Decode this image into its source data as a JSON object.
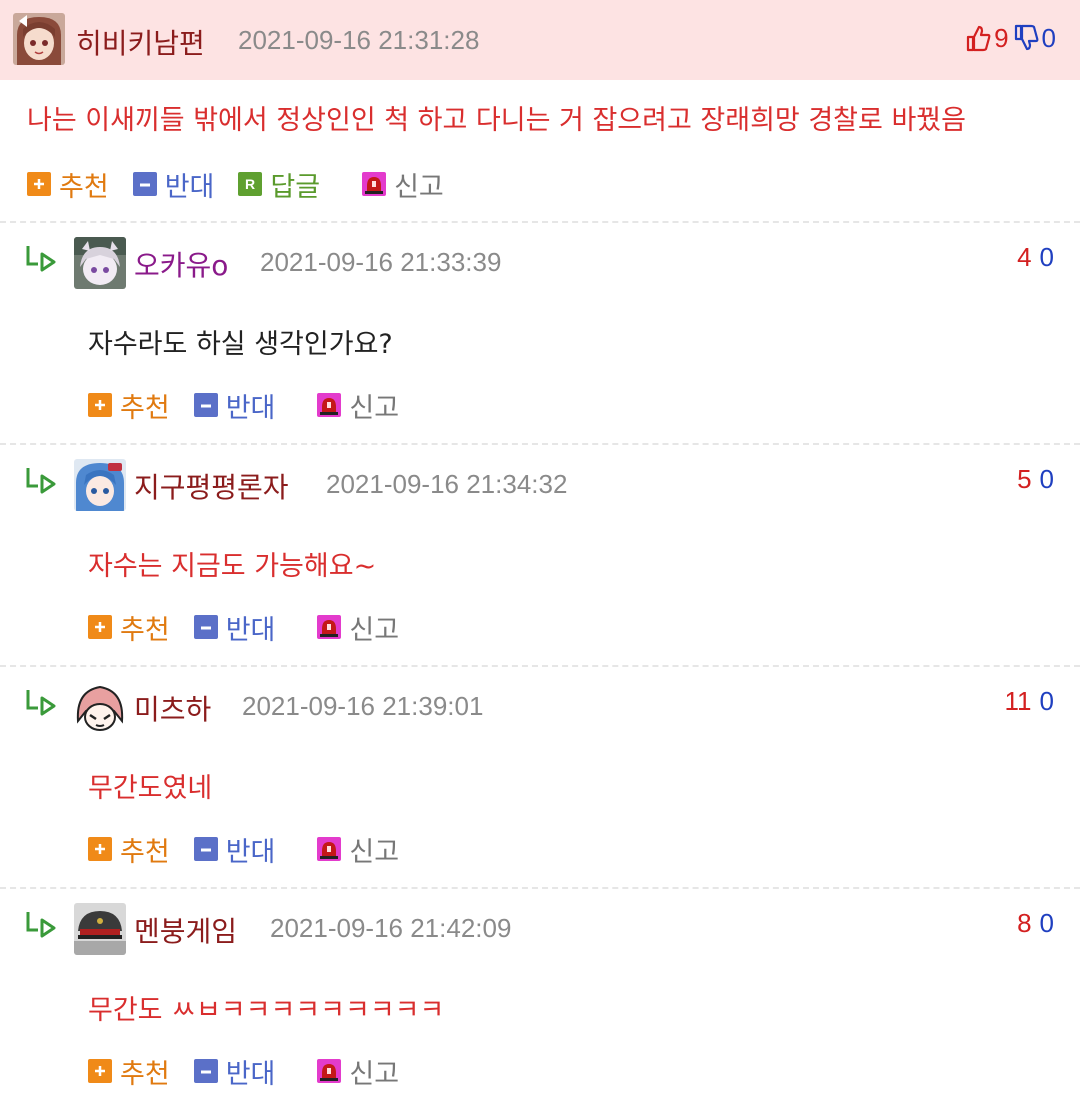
{
  "post": {
    "nickname": "히비키남편",
    "timestamp": "2021-09-16 21:31:28",
    "upvotes": "9",
    "downvotes": "0",
    "body": "나는 이새끼들 밖에서 정상인인 척 하고 다니는 거 잡으려고 장래희망 경찰로 바꿨음",
    "body_color": "#d92e2e",
    "actions": {
      "recommend": "추천",
      "oppose": "반대",
      "reply": "답글",
      "report": "신고"
    },
    "action_icons": {
      "recommend": "plus-icon",
      "oppose": "minus-icon",
      "reply": "r-icon",
      "report": "siren-icon"
    }
  },
  "replies": [
    {
      "nickname": "오카유o",
      "nickname_color": "#8a1a8a",
      "timestamp": "2021-09-16 21:33:39",
      "upvotes": "4",
      "downvotes": "0",
      "body": "자수라도 하실 생각인가요?",
      "body_color": "#222222"
    },
    {
      "nickname": "지구평평론자",
      "nickname_color": "#8b1c1c",
      "timestamp": "2021-09-16 21:34:32",
      "upvotes": "5",
      "downvotes": "0",
      "body": "자수는 지금도 가능해요~",
      "body_color": "#d92e2e"
    },
    {
      "nickname": "미츠하",
      "nickname_color": "#8b1c1c",
      "timestamp": "2021-09-16 21:39:01",
      "upvotes": "11",
      "downvotes": "0",
      "body": "무간도였네",
      "body_color": "#d92e2e"
    },
    {
      "nickname": "멘붕게임",
      "nickname_color": "#8b1c1c",
      "timestamp": "2021-09-16 21:42:09",
      "upvotes": "8",
      "downvotes": "0",
      "body": "무간도 ㅆㅂㅋㅋㅋㅋㅋㅋㅋㅋㅋ",
      "body_color": "#d92e2e"
    }
  ],
  "reply_actions": {
    "recommend": "추천",
    "oppose": "반대",
    "report": "신고"
  },
  "colors": {
    "header_bg": "#fde3e3",
    "upvote": "#d32020",
    "downvote": "#1f3fc0",
    "timestamp": "#8a8a8a",
    "reply_arrow": "#3a9a3a"
  },
  "icons": {
    "reply_arrow": "reply-arrow-icon",
    "thumbs_up": "thumbs-up-icon",
    "thumbs_down": "thumbs-down-icon"
  }
}
